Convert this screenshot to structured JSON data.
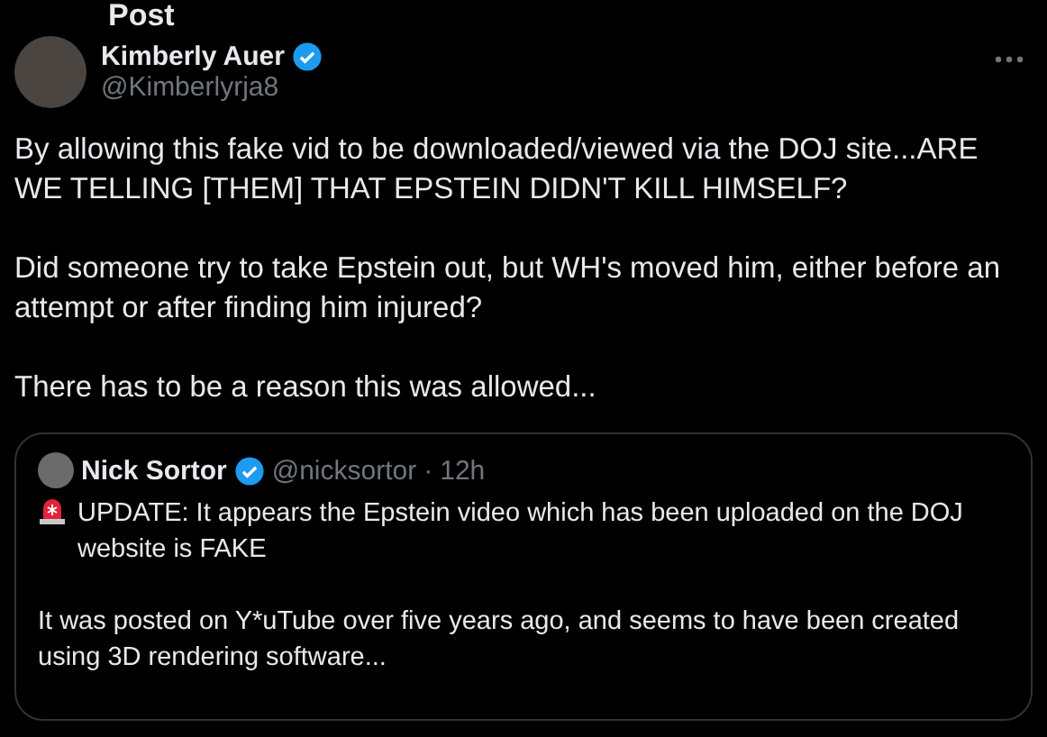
{
  "header": {
    "title": "Post"
  },
  "author": {
    "name": "Kimberly Auer",
    "handle": "@Kimberlyrja8",
    "verified": true
  },
  "body": [
    "By allowing this fake vid to be downloaded/viewed via the DOJ site...ARE WE TELLING [THEM] THAT EPSTEIN DIDN'T KILL HIMSELF?",
    "Did someone try to take Epstein out, but WH's moved him, either before an attempt or after finding him injured?",
    "There has to be a reason this was allowed..."
  ],
  "quote": {
    "name": "Nick Sortor",
    "handle": "@nicksortor",
    "separator": "·",
    "time": "12h",
    "verified": true,
    "body": [
      "UPDATE: It appears the Epstein video which has been uploaded on the DOJ website is FAKE",
      "It was posted on Y*uTube over five years ago, and seems to have been created using 3D rendering software..."
    ]
  }
}
